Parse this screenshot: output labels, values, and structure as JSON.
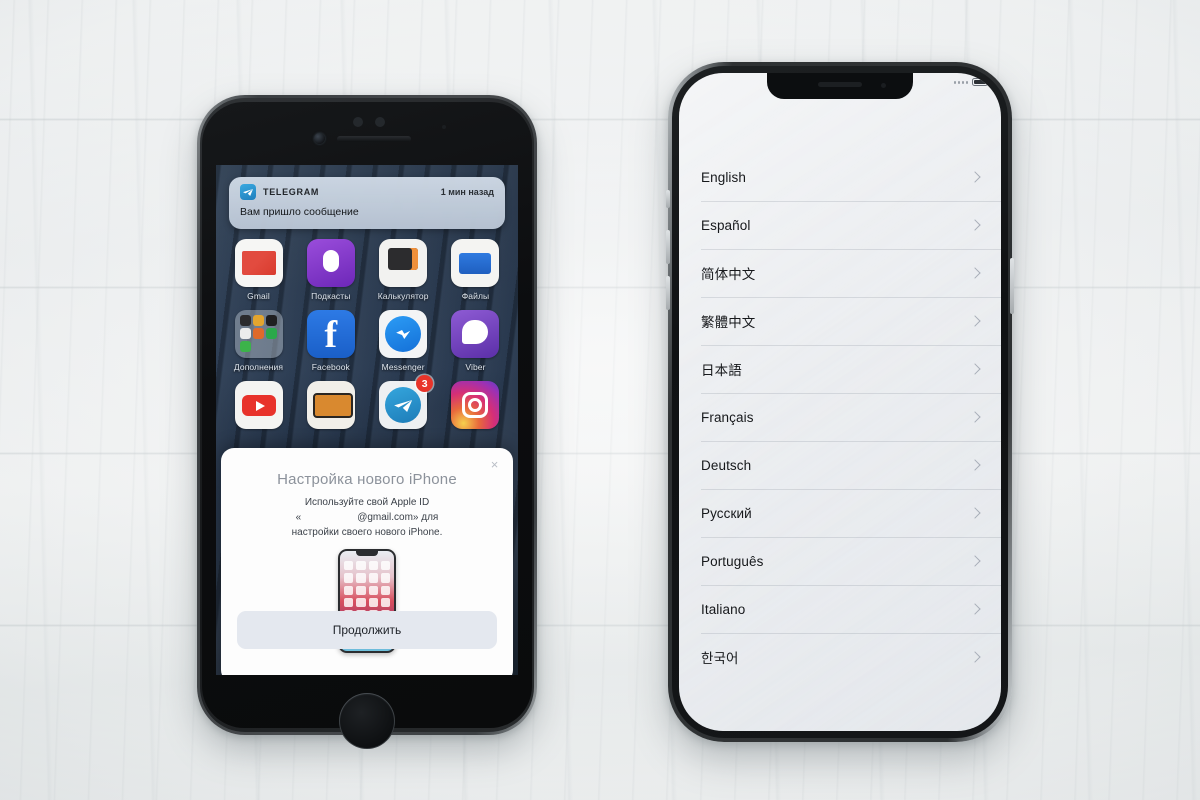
{
  "scene": {
    "background": "white-painted-wood-surface",
    "background_color": "#f2f4f4"
  },
  "left_phone": {
    "model_hint": "iPhone with home button",
    "frame_color": "#3c4043",
    "notification": {
      "app_name": "TELEGRAM",
      "time": "1 мин назад",
      "message": "Вам пришло сообщение",
      "icon": "telegram-icon"
    },
    "home_screen": {
      "rows": [
        [
          {
            "label": "Gmail",
            "icon": "gmail-icon",
            "badge": ""
          },
          {
            "label": "Подкасты",
            "icon": "podcasts-icon",
            "badge": ""
          },
          {
            "label": "Калькулятор",
            "icon": "calculator-icon",
            "badge": ""
          },
          {
            "label": "Файлы",
            "icon": "files-icon",
            "badge": ""
          }
        ],
        [
          {
            "label": "Дополнения",
            "icon": "folder-icon",
            "badge": ""
          },
          {
            "label": "Facebook",
            "icon": "facebook-icon",
            "badge": ""
          },
          {
            "label": "Messenger",
            "icon": "messenger-icon",
            "badge": ""
          },
          {
            "label": "Viber",
            "icon": "viber-icon",
            "badge": ""
          }
        ],
        [
          {
            "label": "",
            "icon": "youtube-icon",
            "badge": ""
          },
          {
            "label": "",
            "icon": "tachku-icon",
            "badge": ""
          },
          {
            "label": "",
            "icon": "telegram-icon",
            "badge": "3"
          },
          {
            "label": "",
            "icon": "instagram-icon",
            "badge": ""
          }
        ]
      ]
    },
    "modal": {
      "close_label": "×",
      "title": "Настройка нового iPhone",
      "body_line1": "Используйте свой Apple ID",
      "body_line2_prefix": "«",
      "body_line2_suffix": "@gmail.com» для",
      "body_line3": "настройки своего нового iPhone.",
      "illustration": "iphone-x-illustration",
      "button_label": "Продолжить"
    }
  },
  "right_phone": {
    "model_hint": "iPhone X with notch",
    "frame_color": "#2e3133",
    "status_bar": {
      "signal_icon": "signal-dots-icon",
      "battery_icon": "battery-icon"
    },
    "language_list": [
      {
        "name": "English"
      },
      {
        "name": "Español"
      },
      {
        "name": "简体中文"
      },
      {
        "name": "繁體中文"
      },
      {
        "name": "日本語"
      },
      {
        "name": "Français"
      },
      {
        "name": "Deutsch"
      },
      {
        "name": "Русский"
      },
      {
        "name": "Português"
      },
      {
        "name": "Italiano"
      },
      {
        "name": "한국어"
      }
    ],
    "row_accessory_icon": "chevron-right-icon"
  }
}
